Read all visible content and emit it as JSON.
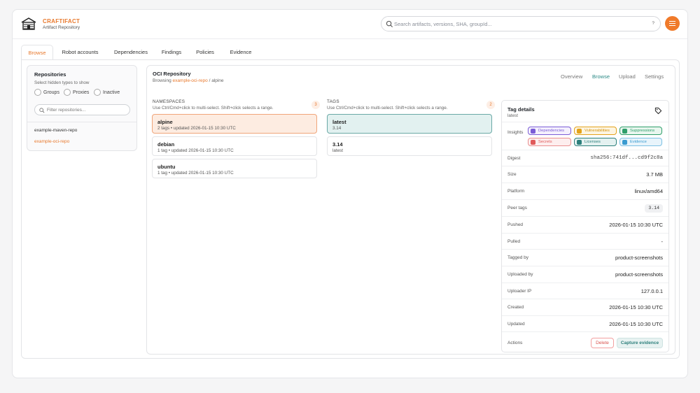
{
  "brand": {
    "name": "CRAFTIFACT",
    "subtitle": "Artifact Repository",
    "logo_icon": "cabin-logo-icon"
  },
  "search": {
    "placeholder": "Search artifacts, versions, SHA, groupId...",
    "shortcut_hint": "?"
  },
  "tabs": [
    {
      "label": "Browse",
      "active": true
    },
    {
      "label": "Robot accounts"
    },
    {
      "label": "Dependencies"
    },
    {
      "label": "Findings"
    },
    {
      "label": "Policies"
    },
    {
      "label": "Evidence"
    }
  ],
  "sidebar": {
    "title": "Repositories",
    "hint": "Select hidden types to show",
    "filters": [
      "Groups",
      "Proxies",
      "Inactive"
    ],
    "filter_placeholder": "Filter repositories...",
    "repos": [
      {
        "name": "example-maven-repo",
        "active": false
      },
      {
        "name": "example-oci-repo",
        "active": true
      }
    ]
  },
  "main": {
    "title": "OCI Repository",
    "crumb_prefix": "Browsing",
    "crumb_repo": "example-oci-repo",
    "crumb_suffix": "/ alpine",
    "subnav": [
      "Overview",
      "Browse",
      "Upload",
      "Settings"
    ],
    "namespaces": {
      "label": "NAMESPACES",
      "hint": "Use Ctrl/Cmd+click to multi-select. Shift+click selects a range.",
      "count": "3",
      "items": [
        {
          "name": "alpine",
          "meta": "2 tags • updated 2026-01-15 10:30 UTC",
          "selected": true
        },
        {
          "name": "debian",
          "meta": "1 tag • updated 2026-01-15 10:30 UTC"
        },
        {
          "name": "ubuntu",
          "meta": "1 tag • updated 2026-01-15 10:30 UTC"
        }
      ]
    },
    "tags": {
      "label": "TAGS",
      "hint": "Use Ctrl/Cmd+click to multi-select. Shift+click selects a range.",
      "count": "2",
      "items": [
        {
          "name": "latest",
          "meta": "3.14",
          "selected": true
        },
        {
          "name": "3.14",
          "meta": "latest"
        }
      ]
    }
  },
  "details": {
    "title": "Tag details",
    "subtitle": "latest",
    "insights_label": "Insights",
    "insights": [
      {
        "label": "Dependencies",
        "color": "#7b5cd6"
      },
      {
        "label": "Vulnerabilities",
        "color": "#e3a21a"
      },
      {
        "label": "Suppressions",
        "color": "#2e9e6a"
      },
      {
        "label": "Secrets",
        "color": "#e05a5a"
      },
      {
        "label": "Licenses",
        "color": "#2c7f7b"
      },
      {
        "label": "Evidence",
        "color": "#3a9bd0"
      }
    ],
    "fields": [
      {
        "label": "Digest",
        "value": "sha256:741df...cd9f2c8a",
        "mono": true
      },
      {
        "label": "Size",
        "value": "3.7 MB"
      },
      {
        "label": "Platform",
        "value": "linux/amd64"
      },
      {
        "label": "Peer tags",
        "value": "3.14",
        "pill": true
      },
      {
        "label": "Pushed",
        "value": "2026-01-15 10:30 UTC"
      },
      {
        "label": "Pulled",
        "value": "-"
      },
      {
        "label": "Tagged by",
        "value": "product-screenshots"
      },
      {
        "label": "Uploaded by",
        "value": "product-screenshots"
      },
      {
        "label": "Uploader IP",
        "value": "127.0.0.1"
      },
      {
        "label": "Created",
        "value": "2026-01-15 10:30 UTC"
      },
      {
        "label": "Updated",
        "value": "2026-01-15 10:30 UTC"
      }
    ],
    "actions_label": "Actions",
    "delete_label": "Delete",
    "capture_label": "Capture evidence"
  },
  "colors": {
    "accent": "#e8792d",
    "teal": "#2c8a86"
  }
}
